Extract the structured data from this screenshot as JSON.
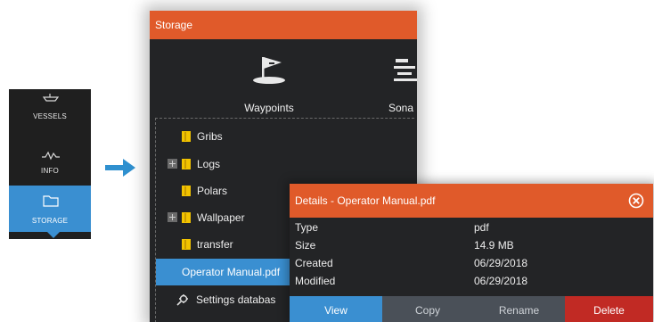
{
  "sidemenu": {
    "items": [
      {
        "label": "VESSELS",
        "icon": "vessels-icon"
      },
      {
        "label": "INFO",
        "icon": "info-wave-icon"
      },
      {
        "label": "STORAGE",
        "icon": "storage-folder-icon",
        "selected": true
      }
    ]
  },
  "storage": {
    "title": "Storage",
    "categories": [
      {
        "label": "Waypoints",
        "icon": "waypoint-flag-icon"
      },
      {
        "label": "Sona",
        "icon": "sonar-icon"
      }
    ],
    "tree": [
      {
        "label": "Gribs",
        "icon": "folder-icon",
        "expandable": false
      },
      {
        "label": "Logs",
        "icon": "folder-icon",
        "expandable": true
      },
      {
        "label": "Polars",
        "icon": "folder-icon",
        "expandable": false
      },
      {
        "label": "Wallpaper",
        "icon": "folder-icon",
        "expandable": true
      },
      {
        "label": "transfer",
        "icon": "folder-icon",
        "expandable": false
      },
      {
        "label": "Operator Manual.pdf",
        "selected": true
      },
      {
        "label": "Settings databas",
        "icon": "settings-database-icon"
      }
    ]
  },
  "details": {
    "title": "Details - Operator Manual.pdf",
    "properties": [
      {
        "name": "Type",
        "value": "pdf"
      },
      {
        "name": "Size",
        "value": "14.9 MB"
      },
      {
        "name": "Created",
        "value": "06/29/2018"
      },
      {
        "name": "Modified",
        "value": "06/29/2018"
      }
    ],
    "actions": {
      "view": "View",
      "copy": "Copy",
      "rename": "Rename",
      "delete": "Delete"
    }
  },
  "colors": {
    "title_bar": "#e05a2a",
    "selection": "#3a8fd1",
    "panel_bg": "#232426",
    "delete": "#c12a24",
    "folder": "#f2c300"
  }
}
